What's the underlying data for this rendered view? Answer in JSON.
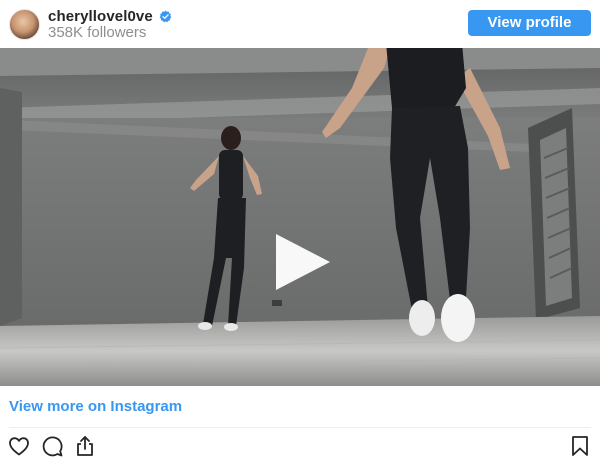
{
  "header": {
    "username": "cheryllovel0ve",
    "followers": "358K followers",
    "view_profile_label": "View profile",
    "verified_icon": "verified-badge-icon"
  },
  "media": {
    "type": "video",
    "play_icon": "play-icon"
  },
  "footer": {
    "view_more_label": "View more on Instagram"
  },
  "actions": {
    "icons": [
      "heart-icon",
      "comment-icon",
      "share-icon",
      "bookmark-icon"
    ]
  },
  "colors": {
    "accent": "#3897f0",
    "text": "#262626",
    "secondary_text": "#8e8e8e"
  }
}
